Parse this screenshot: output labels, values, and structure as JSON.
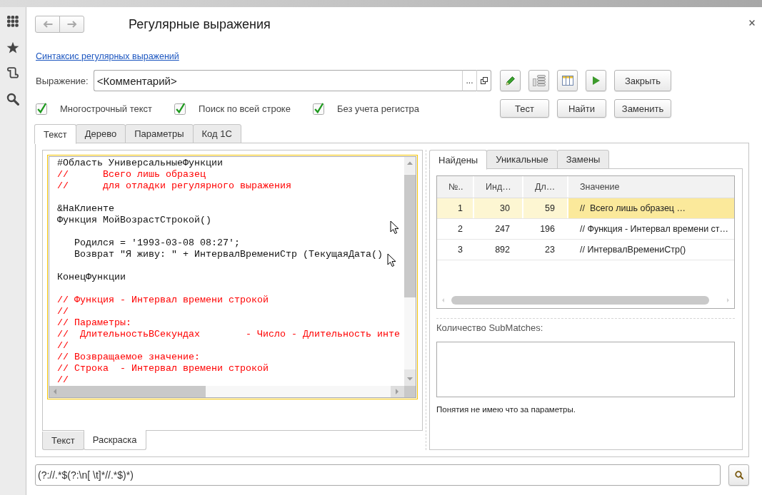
{
  "window": {
    "title": "Регулярные выражения"
  },
  "syntax_link": "Синтаксис регулярных выражений",
  "expression": {
    "label": "Выражение:",
    "value": "<Комментарий>",
    "choice_button": "..."
  },
  "options": [
    {
      "label": "Многострочный текст",
      "checked": true
    },
    {
      "label": "Поиск по всей строке",
      "checked": true
    },
    {
      "label": "Без учета регистра",
      "checked": true
    }
  ],
  "close_button": "Закрыть",
  "action_buttons": [
    "Тест",
    "Найти",
    "Заменить"
  ],
  "tabs": [
    {
      "label": "Текст",
      "selected": true
    },
    {
      "label": "Дерево",
      "selected": false
    },
    {
      "label": "Параметры",
      "selected": false
    },
    {
      "label": "Код 1С",
      "selected": false
    }
  ],
  "editor": {
    "lines": [
      {
        "kind": "code",
        "text": "#Область УниверсальныеФункции"
      },
      {
        "kind": "comment",
        "text": "//      Всего лишь образец"
      },
      {
        "kind": "comment",
        "text": "//      для отладки регулярного выражения"
      },
      {
        "kind": "blank"
      },
      {
        "kind": "code",
        "text": "&НаКлиенте"
      },
      {
        "kind": "code",
        "text": "Функция МойВозрастСтрокой()"
      },
      {
        "kind": "blank"
      },
      {
        "kind": "code",
        "text": "   Родился = '1993-03-08 08:27';"
      },
      {
        "kind": "code",
        "text": "   Возврат \"Я живу: \" + ИнтервалВремениСтр (ТекущаяДата()"
      },
      {
        "kind": "blank"
      },
      {
        "kind": "code",
        "text": "КонецФункции"
      },
      {
        "kind": "blank"
      },
      {
        "kind": "comment",
        "text": "// Функция - Интервал времени строкой"
      },
      {
        "kind": "comment",
        "text": "//"
      },
      {
        "kind": "comment",
        "text": "// Параметры:"
      },
      {
        "kind": "comment",
        "text": "//  ДлительностьВСекундах        - Число - Длительность инте"
      },
      {
        "kind": "comment",
        "text": "//"
      },
      {
        "kind": "comment",
        "text": "// Возвращаемое значение:"
      },
      {
        "kind": "comment",
        "text": "// Строка  - Интервал времени строкой"
      },
      {
        "kind": "comment",
        "text": "//"
      }
    ],
    "tabs": [
      {
        "label": "Текст",
        "selected": false
      },
      {
        "label": "Раскраска",
        "selected": true
      }
    ]
  },
  "results": {
    "tabs": [
      {
        "label": "Найдены",
        "selected": true
      },
      {
        "label": "Уникальные",
        "selected": false
      },
      {
        "label": "Замены",
        "selected": false
      }
    ],
    "table": {
      "columns": [
        "№..",
        "Инд…",
        "Дл…",
        "Значение"
      ],
      "rows": [
        {
          "selected": true,
          "cells": [
            {
              "text": "1",
              "focused": false
            },
            {
              "text": "30",
              "focused": false
            },
            {
              "text": "59",
              "focused": false
            },
            {
              "text": "//  Всего лишь образец …",
              "focused": true
            }
          ]
        },
        {
          "selected": false,
          "cells": [
            {
              "text": "2",
              "focused": false
            },
            {
              "text": "247",
              "focused": false
            },
            {
              "text": "196",
              "focused": false
            },
            {
              "text": "// Функция - Интервал времени ст…",
              "focused": false
            }
          ]
        },
        {
          "selected": false,
          "cells": [
            {
              "text": "3",
              "focused": false
            },
            {
              "text": "892",
              "focused": false
            },
            {
              "text": "23",
              "focused": false
            },
            {
              "text": "// ИнтервалВремениСтр()",
              "focused": false
            }
          ]
        }
      ]
    },
    "submatches_label": "Количество SubMatches:",
    "note": "Понятия не имею что за параметры."
  },
  "pattern": {
    "value": "(?://.*$(?:\\n[ \\t]*//.*$)*)"
  }
}
